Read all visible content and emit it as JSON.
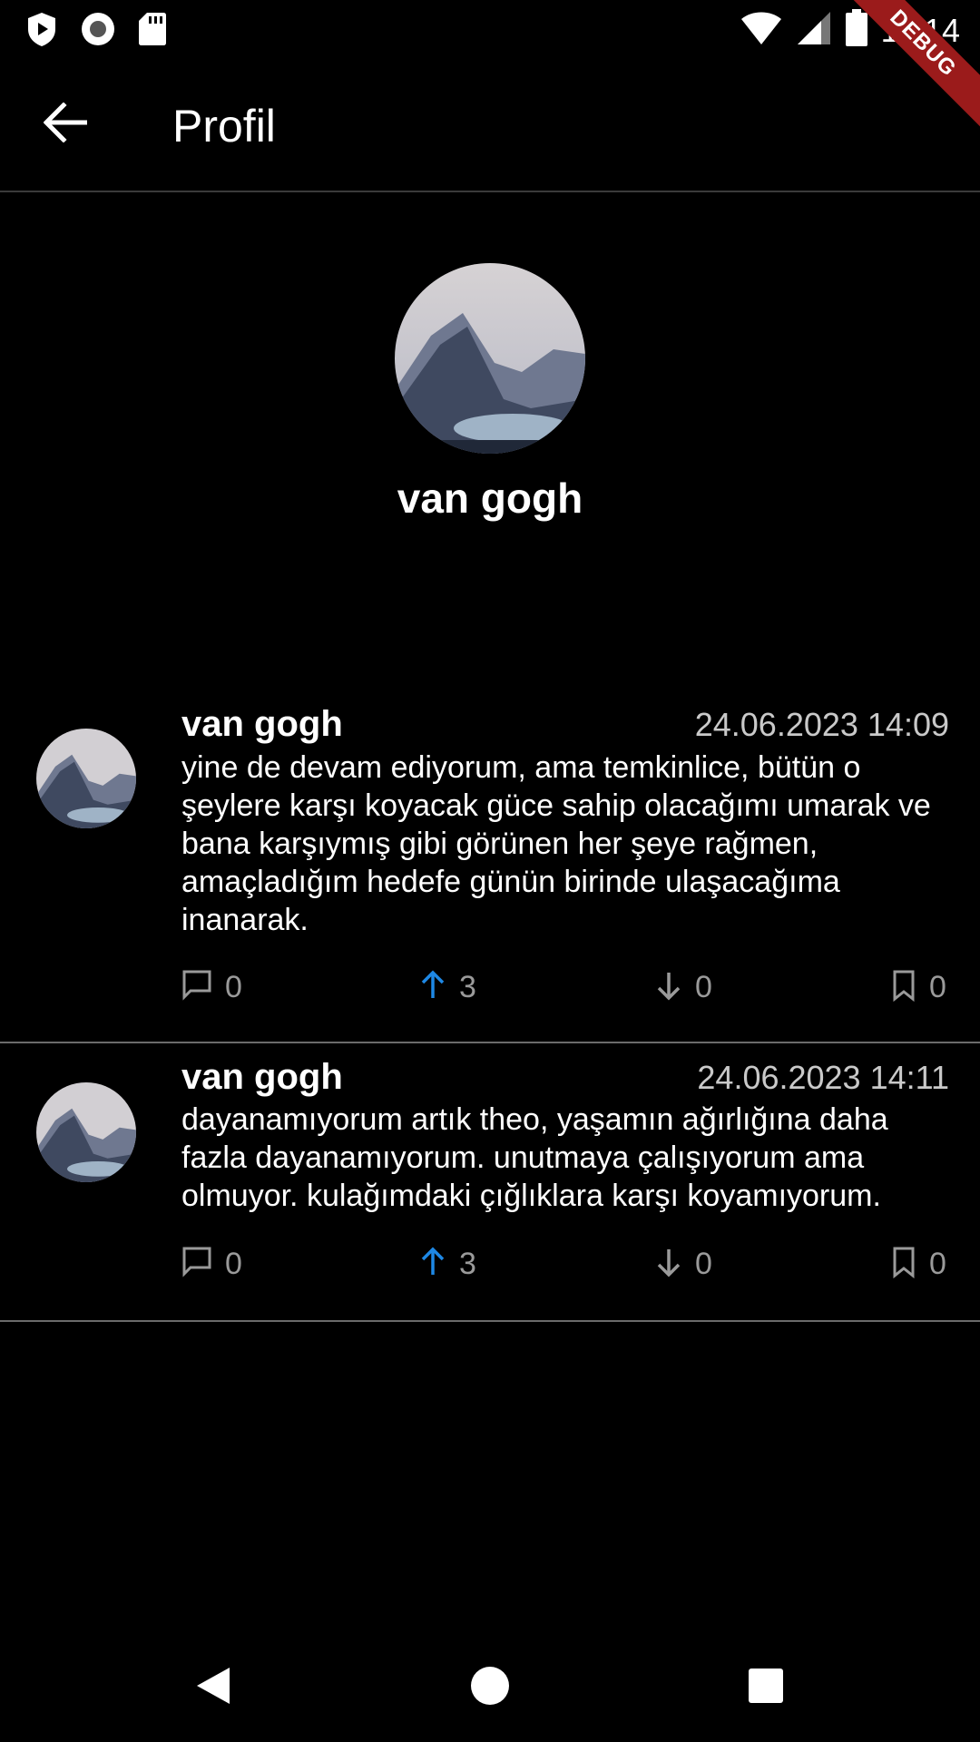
{
  "status_bar": {
    "time": "11:14",
    "debug_label": "DEBUG",
    "left_icons": [
      "play-protect-icon",
      "record-icon",
      "sd-card-icon"
    ],
    "right_icons": [
      "wifi-icon",
      "signal-icon",
      "battery-icon"
    ]
  },
  "app_bar": {
    "title": "Profil",
    "back_icon": "arrow-left-icon"
  },
  "profile": {
    "name": "van gogh"
  },
  "posts": [
    {
      "author": "van gogh",
      "timestamp": "24.06.2023 14:09",
      "body": "yine de devam ediyorum, ama temkinlice, bütün o şeylere karşı koyacak güce sahip olacağımı umarak ve bana karşıymış gibi görünen her şeye rağmen, amaçladığım hedefe günün birinde ulaşacağıma inanarak.",
      "comments": "0",
      "upvotes": "3",
      "downvotes": "0",
      "bookmarks": "0"
    },
    {
      "author": "van gogh",
      "timestamp": "24.06.2023 14:11",
      "body": "dayanamıyorum artık theo, yaşamın ağırlığına daha fazla dayanamıyorum. unutmaya çalışıyorum ama olmuyor. kulağımdaki çığlıklara karşı koyamıyorum.",
      "comments": "0",
      "upvotes": "3",
      "downvotes": "0",
      "bookmarks": "0"
    }
  ],
  "colors": {
    "background": "#000000",
    "accent_upvote": "#1e88e5",
    "muted": "#9a9a9a",
    "debug_ribbon": "#9b1b1b"
  },
  "nav_bar": {
    "icons": [
      "back-triangle-icon",
      "home-circle-icon",
      "recents-square-icon"
    ]
  }
}
